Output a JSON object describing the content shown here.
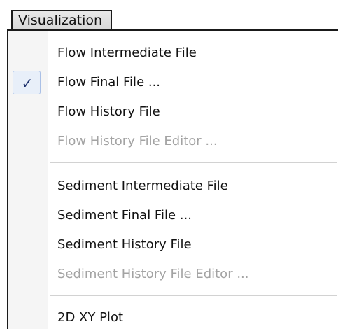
{
  "menu": {
    "title": "Visualization",
    "checkmark": "✓",
    "groups": [
      {
        "items": [
          {
            "label": "Flow Intermediate File",
            "enabled": true,
            "checked": false
          },
          {
            "label": "Flow Final File ...",
            "enabled": true,
            "checked": true
          },
          {
            "label": "Flow History File",
            "enabled": true,
            "checked": false
          },
          {
            "label": "Flow History File Editor ...",
            "enabled": false,
            "checked": false
          }
        ]
      },
      {
        "items": [
          {
            "label": "Sediment Intermediate File",
            "enabled": true,
            "checked": false
          },
          {
            "label": "Sediment Final File ...",
            "enabled": true,
            "checked": false
          },
          {
            "label": "Sediment History File",
            "enabled": true,
            "checked": false
          },
          {
            "label": "Sediment History File Editor ...",
            "enabled": false,
            "checked": false
          }
        ]
      },
      {
        "items": [
          {
            "label": "2D XY Plot",
            "enabled": true,
            "checked": false
          }
        ]
      }
    ],
    "colors": {
      "text": "#121212",
      "disabled_text": "#a3a3a3",
      "check_highlight": "#e8eff9",
      "check_border": "#aac0e6"
    }
  }
}
